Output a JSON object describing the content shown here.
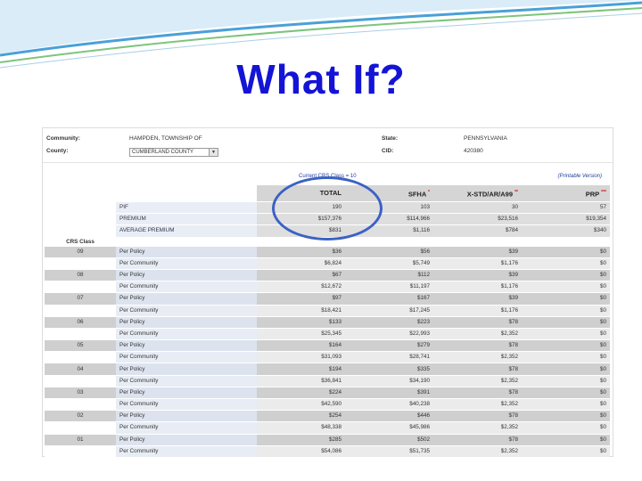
{
  "slide": {
    "title": "What If?"
  },
  "colors": {
    "title": "#1414d6",
    "deco_blue": "#4aa0d8",
    "deco_green": "#7dc47d",
    "oval": "#3b62c4",
    "link": "#1f3f99"
  },
  "header": {
    "community_label": "Community:",
    "community_value": "HAMPDEN, TOWNSHIP OF",
    "county_label": "County:",
    "county_value": "CUMBERLAND COUNTY",
    "state_label": "State:",
    "state_value": "PENNSYLVANIA",
    "cid_label": "CID:",
    "cid_value": "420380"
  },
  "crs": {
    "current_label": "Current CRS Class",
    "current_eq": "=",
    "current_value": "10",
    "printable": "(Printable Version)",
    "class_header": "CRS Class"
  },
  "table": {
    "columns": [
      {
        "label": "TOTAL",
        "star": ""
      },
      {
        "label": "SFHA",
        "star": "*"
      },
      {
        "label": "X-STD/AR/A99",
        "star": "**"
      },
      {
        "label": "PRP",
        "star": "***"
      }
    ],
    "summary": [
      {
        "label": "PIF",
        "values": [
          "190",
          "103",
          "30",
          "57"
        ]
      },
      {
        "label": "PREMIUM",
        "values": [
          "$157,376",
          "$114,966",
          "$23,516",
          "$19,354"
        ]
      },
      {
        "label": "AVERAGE PREMIUM",
        "values": [
          "$831",
          "$1,116",
          "$784",
          "$340"
        ]
      }
    ],
    "classes": [
      {
        "crs": "09",
        "per_policy": [
          "$36",
          "$56",
          "$39",
          "$0"
        ],
        "per_community": [
          "$6,824",
          "$5,749",
          "$1,176",
          "$0"
        ]
      },
      {
        "crs": "08",
        "per_policy": [
          "$67",
          "$112",
          "$39",
          "$0"
        ],
        "per_community": [
          "$12,672",
          "$11,197",
          "$1,176",
          "$0"
        ]
      },
      {
        "crs": "07",
        "per_policy": [
          "$97",
          "$167",
          "$39",
          "$0"
        ],
        "per_community": [
          "$18,421",
          "$17,245",
          "$1,176",
          "$0"
        ]
      },
      {
        "crs": "06",
        "per_policy": [
          "$133",
          "$223",
          "$78",
          "$0"
        ],
        "per_community": [
          "$25,345",
          "$22,993",
          "$2,352",
          "$0"
        ]
      },
      {
        "crs": "05",
        "per_policy": [
          "$164",
          "$279",
          "$78",
          "$0"
        ],
        "per_community": [
          "$31,093",
          "$28,741",
          "$2,352",
          "$0"
        ]
      },
      {
        "crs": "04",
        "per_policy": [
          "$194",
          "$335",
          "$78",
          "$0"
        ],
        "per_community": [
          "$36,841",
          "$34,190",
          "$2,352",
          "$0"
        ]
      },
      {
        "crs": "03",
        "per_policy": [
          "$224",
          "$391",
          "$78",
          "$0"
        ],
        "per_community": [
          "$42,590",
          "$40,238",
          "$2,352",
          "$0"
        ]
      },
      {
        "crs": "02",
        "per_policy": [
          "$254",
          "$446",
          "$78",
          "$0"
        ],
        "per_community": [
          "$48,338",
          "$45,986",
          "$2,352",
          "$0"
        ]
      },
      {
        "crs": "01",
        "per_policy": [
          "$285",
          "$502",
          "$78",
          "$0"
        ],
        "per_community": [
          "$54,086",
          "$51,735",
          "$2,352",
          "$0"
        ]
      }
    ],
    "per_policy_label": "Per Policy",
    "per_community_label": "Per Community"
  }
}
